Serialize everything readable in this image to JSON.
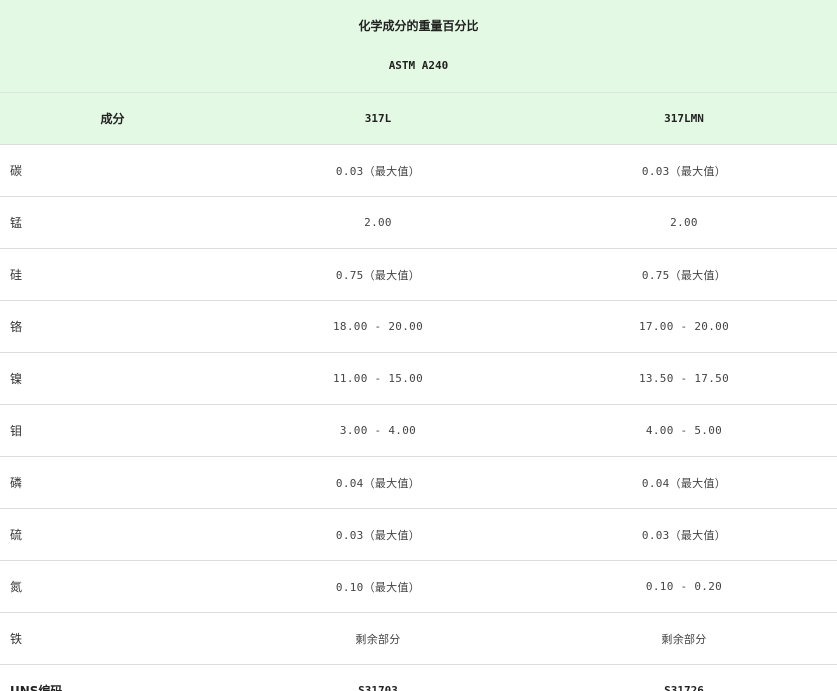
{
  "table": {
    "title": "化学成分的重量百分比",
    "subtitle": "ASTM A240",
    "headers": [
      "成分",
      "317L",
      "317LMN"
    ],
    "rows": [
      {
        "name": "碳",
        "v1": "0.03（最大值）",
        "v2": "0.03（最大值）"
      },
      {
        "name": "锰",
        "v1": "2.00",
        "v2": "2.00"
      },
      {
        "name": "硅",
        "v1": "0.75（最大值）",
        "v2": "0.75（最大值）"
      },
      {
        "name": "铬",
        "v1": "18.00 - 20.00",
        "v2": "17.00 - 20.00"
      },
      {
        "name": "镍",
        "v1": "11.00 - 15.00",
        "v2": "13.50 - 17.50"
      },
      {
        "name": "钼",
        "v1": "3.00 - 4.00",
        "v2": "4.00 - 5.00"
      },
      {
        "name": "磷",
        "v1": "0.04（最大值）",
        "v2": "0.04（最大值）"
      },
      {
        "name": "硫",
        "v1": "0.03（最大值）",
        "v2": "0.03（最大值）"
      },
      {
        "name": "氮",
        "v1": "0.10（最大值）",
        "v2": "0.10 - 0.20"
      },
      {
        "name": "铁",
        "v1": "剩余部分",
        "v2": "剩余部分"
      }
    ],
    "uns": {
      "name": "UNS编码",
      "v1": "S31703",
      "v2": "S31726"
    }
  }
}
